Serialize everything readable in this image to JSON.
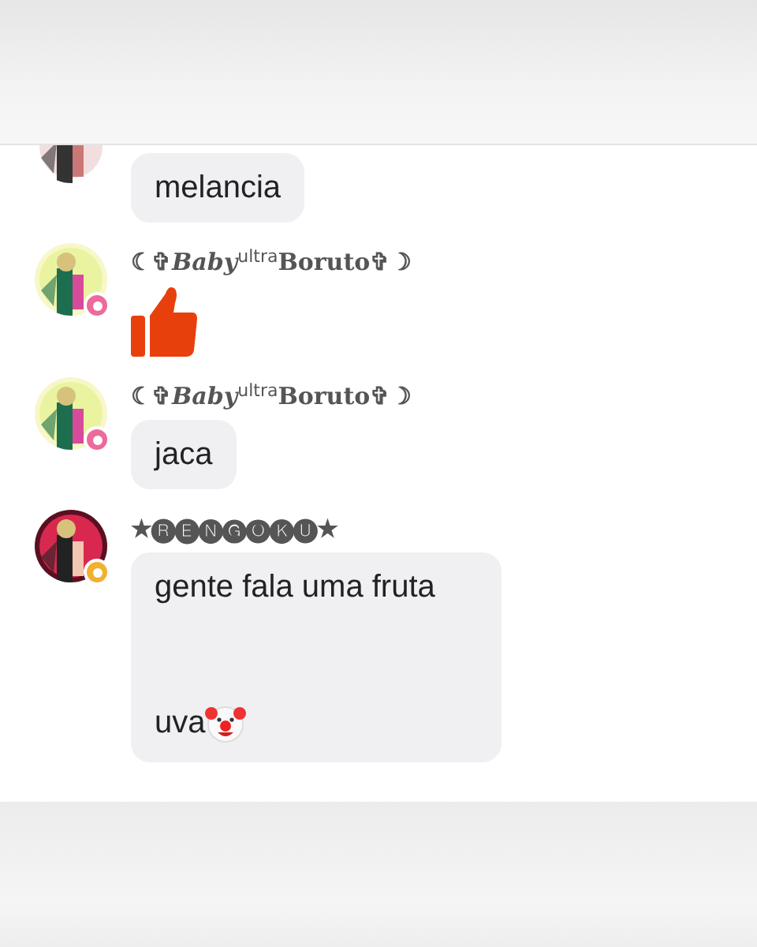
{
  "messages": [
    {
      "kind": "text",
      "lines": [
        {
          "kind": "plain",
          "text": "melancia"
        }
      ]
    },
    {
      "kind": "sticker",
      "sender": "☾✞*Baby*$^{ultra}$**Boruto**✞☽",
      "badge": {
        "color": "#ec6a9c"
      }
    },
    {
      "kind": "text",
      "sender": "☾✞*Baby*$^{ultra}$**Boruto**✞☽",
      "badge": {
        "color": "#ec6a9c"
      },
      "lines": [
        {
          "kind": "plain",
          "text": "jaca"
        }
      ]
    },
    {
      "kind": "text",
      "sender": "★🅡🅔🅝🅖🅞🅚🅤★",
      "badge": {
        "color": "#f2b030"
      },
      "lines": [
        {
          "kind": "plain",
          "text": "gente fala uma fruta"
        },
        {
          "kind": "clown",
          "text": "uva"
        }
      ]
    }
  ]
}
